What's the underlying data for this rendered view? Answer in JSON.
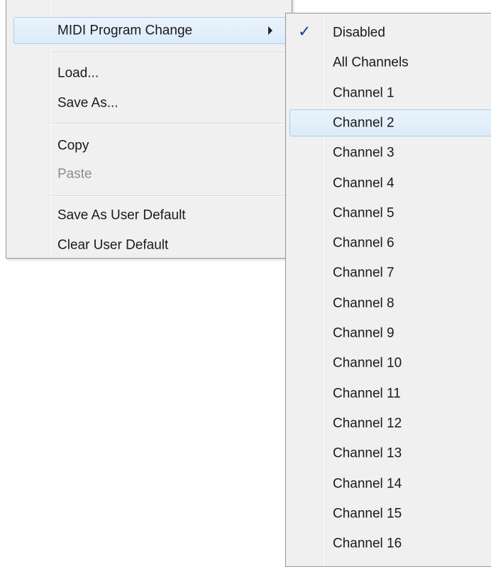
{
  "main_menu": {
    "items": [
      {
        "label": "MIDI Program Change",
        "highlighted": true,
        "has_submenu": true
      },
      {
        "label": "Load...",
        "disabled": false
      },
      {
        "label": "Save As...",
        "disabled": false
      },
      {
        "label": "Copy",
        "disabled": false
      },
      {
        "label": "Paste",
        "disabled": true
      },
      {
        "label": "Save As User Default",
        "disabled": false
      },
      {
        "label": "Clear User Default",
        "disabled": false
      }
    ]
  },
  "submenu": {
    "checked_index": 0,
    "highlighted_index": 3,
    "check_glyph": "✓",
    "items": [
      "Disabled",
      "All Channels",
      "Channel 1",
      "Channel 2",
      "Channel 3",
      "Channel 4",
      "Channel 5",
      "Channel 6",
      "Channel 7",
      "Channel 8",
      "Channel 9",
      "Channel 10",
      "Channel 11",
      "Channel 12",
      "Channel 13",
      "Channel 14",
      "Channel 15",
      "Channel 16"
    ]
  },
  "colors": {
    "menu_background": "#f0f0f0",
    "highlight_border": "#a8cdea",
    "highlight_fill": "#dcebfa",
    "disabled_text": "#8d8d8d",
    "check_mark": "#1b3f8f"
  }
}
